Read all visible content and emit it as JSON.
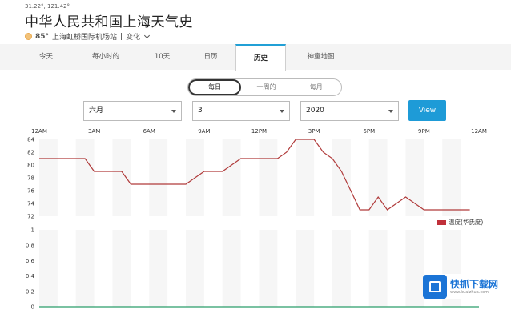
{
  "header": {
    "coords": "31.22°, 121.42°",
    "title": "中华人民共和国上海天气史",
    "current_temp": "85°",
    "location": "上海虹桥国际机场站",
    "separator": "|",
    "change_label": "变化"
  },
  "tabs": [
    {
      "label": "今天",
      "active": false
    },
    {
      "label": "每小时的",
      "active": false
    },
    {
      "label": "10天",
      "active": false
    },
    {
      "label": "日历",
      "active": false
    },
    {
      "label": "历史",
      "active": true
    },
    {
      "label": "神童地图",
      "active": false
    }
  ],
  "period_toggle": [
    {
      "label": "每日",
      "active": true
    },
    {
      "label": "一周的",
      "active": false
    },
    {
      "label": "每月",
      "active": false
    }
  ],
  "filters": {
    "month": "六月",
    "day": "3",
    "year": "2020",
    "view_label": "View"
  },
  "colors": {
    "accent": "#1e9bd7",
    "temp_line": "#b03a3a",
    "precip_line": "#2a9d6a"
  },
  "chart_data": [
    {
      "type": "line",
      "title": "",
      "x_ticks": [
        "12AM",
        "3AM",
        "6AM",
        "9AM",
        "12PM",
        "3PM",
        "6PM",
        "9PM",
        "12AM"
      ],
      "ylim": [
        72,
        84
      ],
      "y_ticks": [
        84,
        82,
        80,
        78,
        76,
        74,
        72
      ],
      "series": [
        {
          "name": "温度(华氏度)",
          "x": [
            0,
            1,
            2,
            2.5,
            3,
            4,
            4.5,
            5,
            6,
            6.5,
            7,
            8,
            9,
            10,
            11,
            11.5,
            12,
            13,
            13.5,
            14,
            14.5,
            15,
            15.5,
            16,
            16.5,
            17,
            17.5,
            18,
            18.5,
            19,
            20,
            21,
            22,
            23,
            23.5
          ],
          "values": [
            81,
            81,
            81,
            81,
            79,
            79,
            79,
            77,
            77,
            77,
            77,
            77,
            79,
            79,
            81,
            81,
            81,
            81,
            82,
            84,
            84,
            84,
            82,
            81,
            79,
            76,
            73,
            73,
            75,
            73,
            75,
            73,
            73,
            73,
            73
          ]
        }
      ],
      "legend": "right"
    },
    {
      "type": "line",
      "title": "",
      "ylim": [
        0,
        1
      ],
      "y_ticks": [
        "1",
        "0.8",
        "0.6",
        "0.4",
        "0.2",
        "0"
      ],
      "series": [
        {
          "name": "",
          "x": [
            0,
            24
          ],
          "values": [
            0,
            0
          ]
        }
      ]
    }
  ],
  "watermark": {
    "text": "快抓下载网",
    "url": "www.kuaizhua.com",
    "icon": "cube-icon"
  }
}
